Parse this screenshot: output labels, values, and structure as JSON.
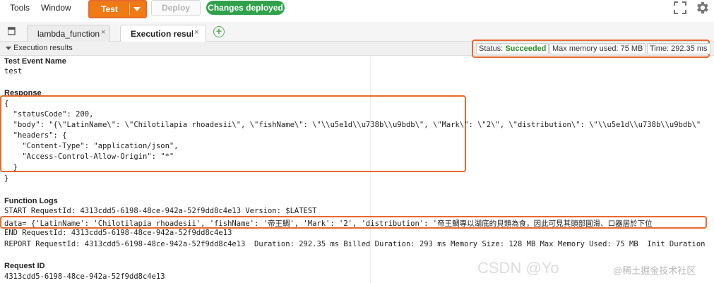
{
  "menu": {
    "tools": "Tools",
    "window": "Window"
  },
  "toolbar": {
    "test_label": "Test",
    "deploy_label": "Deploy",
    "deployed_badge": "Changes deployed"
  },
  "tabs": [
    {
      "label": "lambda_function",
      "close": "×"
    },
    {
      "label": "Execution results",
      "close": "×"
    }
  ],
  "tab_add": "+",
  "panel": {
    "title": "Execution results",
    "status_label": "Status:",
    "status_value": "Succeeded",
    "memory": "Max memory used: 75 MB",
    "time": "Time: 292.35 ms"
  },
  "content": {
    "test_event_heading": "Test Event Name",
    "test_event_value": "test",
    "response_heading": "Response",
    "response_lines": [
      "{",
      "  \"statusCode\": 200,",
      "  \"body\": \"{\\\"LatinName\\\": \\\"Chilotilapia rhoadesii\\\", \\\"fishName\\\": \\\"\\\\u5e1d\\\\u738b\\\\u9bdb\\\", \\\"Mark\\\": \\\"2\\\", \\\"distribution\\\": \\\"\\\\u5e1d\\\\u738b\\\\u9bdb\\\"",
      "  \"headers\": {",
      "    \"Content-Type\": \"application/json\",",
      "    \"Access-Control-Allow-Origin\": \"*\"",
      "  }",
      "}"
    ],
    "logs_heading": "Function Logs",
    "log_lines": [
      "START RequestId: 4313cdd5-6198-48ce-942a-52f9dd8c4e13 Version: $LATEST",
      "data= {'LatinName': 'Chilotilapia rhoadesii', 'fishName': '帝王鯛', 'Mark': '2', 'distribution': '帝王鯛專以湖底的貝類為食，因此可見其頭部圓滑、口器居於下位",
      "END RequestId: 4313cdd5-6198-48ce-942a-52f9dd8c4e13",
      "REPORT RequestId: 4313cdd5-6198-48ce-942a-52f9dd8c4e13  Duration: 292.35 ms Billed Duration: 293 ms Memory Size: 128 MB Max Memory Used: 75 MB  Init Duration"
    ],
    "request_id_heading": "Request ID",
    "request_id_value": "4313cdd5-6198-48ce-942a-52f9dd8c4e13"
  },
  "watermark": {
    "left": "CSDN @Yo",
    "right": "@稀土掘金技术社区"
  },
  "colors": {
    "accent": "#f07a14",
    "highlight_border": "#e8692e",
    "success": "#2fa14a"
  },
  "icons": [
    "fullscreen-icon",
    "gear-icon",
    "tab-list-icon",
    "add-tab-icon",
    "collapse-caret-icon"
  ]
}
